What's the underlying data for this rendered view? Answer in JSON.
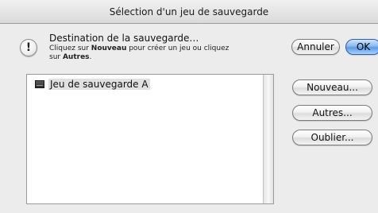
{
  "dialog": {
    "title": "Sélection d'un jeu de sauvegarde",
    "heading": "Destination de la sauvegarde…",
    "instruction": {
      "line1_prefix": "Cliquez sur ",
      "line1_bold": "Nouveau",
      "line1_suffix": " pour créer un jeu ou cliquez",
      "line2_prefix": "sur ",
      "line2_bold": "Autres",
      "line2_suffix": "."
    },
    "icons": {
      "alert": "caution-icon",
      "alert_glyph": "!",
      "set": "backup-set-icon"
    }
  },
  "buttons": {
    "cancel": "Annuler",
    "ok": "OK",
    "new": "Nouveau...",
    "other": "Autres...",
    "forget": "Oublier..."
  },
  "backup_sets": [
    {
      "label": "Jeu de sauvegarde A",
      "selected": true
    }
  ],
  "colors": {
    "default_button": "#5a9be6",
    "selection": "#e1e1e1"
  }
}
